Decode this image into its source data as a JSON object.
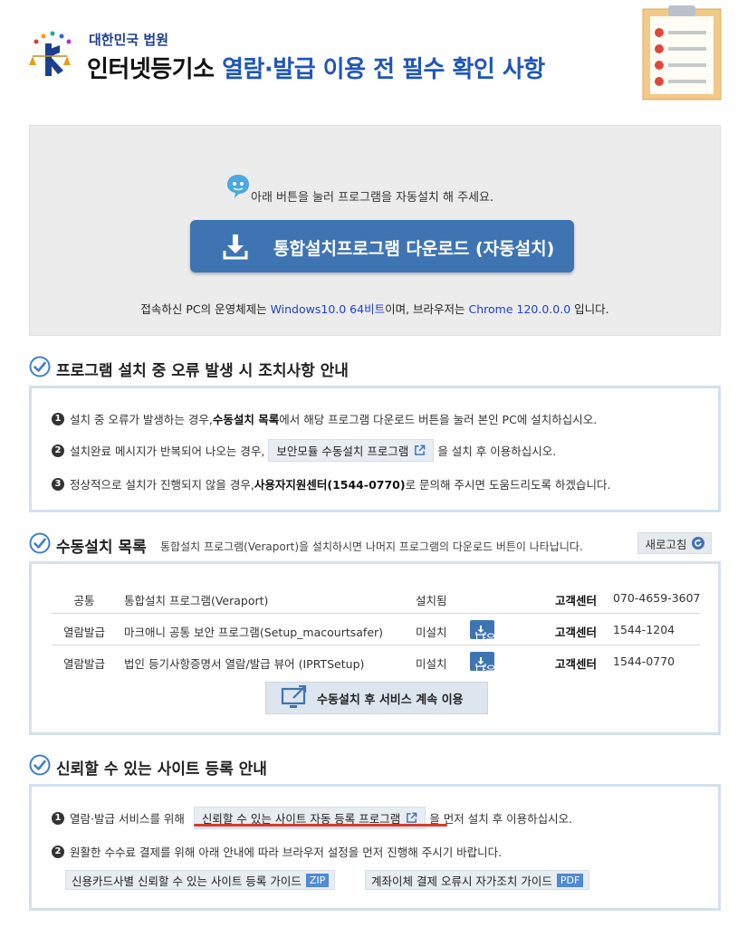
{
  "header": {
    "court_name": "대한민국 법원",
    "title_prefix": "인터넷등기소 ",
    "title_highlight": "열람·발급 이용 전 필수 확인 사항",
    "logo_icon": "supreme-court-logo",
    "clipboard_icon": "checklist-clipboard-icon"
  },
  "download": {
    "guide_text": "아래 버튼을 눌러 프로그램을 자동설치 해 주세요.",
    "button_label": "통합설치프로그램 다운로드 (자동설치)",
    "env_prefix": "접속하신 PC의 운영체제는 ",
    "os": "Windows10.0 64비트",
    "env_middle": "이며, 브라우저는 ",
    "browser": "Chrome 120.0.0.0",
    "env_suffix": " 입니다."
  },
  "error_section": {
    "title": "프로그램 설치 중 오류 발생 시 조치사항 안내",
    "item1_num": "1",
    "item1_pre": "설치 중 오류가 발생하는 경우, ",
    "item1_bold": "수동설치 목록",
    "item1_post": "에서 해당 프로그램 다운로드 버튼을 눌러 본인 PC에 설치하십시오.",
    "item2_num": "2",
    "item2_pre": "설치완료 메시지가 반복되어 나오는 경우,",
    "item2_button": "보안모듈 수동설치 프로그램",
    "item2_post": "을 설치 후 이용하십시오.",
    "item3_num": "3",
    "item3_pre": "정상적으로 설치가 진행되지 않을 경우, ",
    "item3_bold": "사용자지원센터(1544-0770)",
    "item3_post": "로 문의해 주시면 도움드리도록 하겠습니다."
  },
  "manual_section": {
    "title": "수동설치 목록",
    "subtitle": "통합설치 프로그램(Veraport)을 설치하시면 나머지 프로그램의 다운로드 버튼이 나타납니다.",
    "refresh_label": "새로고침",
    "rows": [
      {
        "category": "공통",
        "name": "통합설치 프로그램(Veraport)",
        "status": "설치됨",
        "button": "",
        "cs_label": "고객센터",
        "tel": "070-4659-3607"
      },
      {
        "category": "열람발급",
        "name": "마크애니 공통 보안 프로그램(Setup_macourtsafer)",
        "status": "미설치",
        "button": "다운로드",
        "cs_label": "고객센터",
        "tel": "1544-1204"
      },
      {
        "category": "열람발급",
        "name": "법인 등기사항증명서 열람/발급 뷰어 (IPRTSetup)",
        "status": "미설치",
        "button": "다운로드",
        "cs_label": "고객센터",
        "tel": "1544-0770"
      }
    ],
    "continue_label": "수동설치 후 서비스 계속 이용"
  },
  "trusted_section": {
    "title": "신뢰할 수 있는 사이트 등록 안내",
    "item1_num": "1",
    "item1_pre": "열람·발급 서비스를 위해",
    "item1_button": "신뢰할 수 있는 사이트 자동 등록 프로그램",
    "item1_post": "을 먼저 설치 후 이용하십시오.",
    "item2_num": "2",
    "item2_text": "원활한 수수료 결제를 위해 아래 안내에 따라 브라우저 설정을 먼저 진행해 주시기 바랍니다.",
    "guide1_label": "신용카드사별 신뢰할 수 있는 사이트 등록 가이드",
    "guide1_tag": "ZIP",
    "guide2_label": "계좌이체 결제 오류시 자가조치 가이드",
    "guide2_tag": "PDF"
  },
  "colors": {
    "accent_blue": "#3f74b3",
    "title_blue": "#1e56b8",
    "panel_border": "#d3e0ee",
    "highlight_red": "#d93a2b"
  }
}
